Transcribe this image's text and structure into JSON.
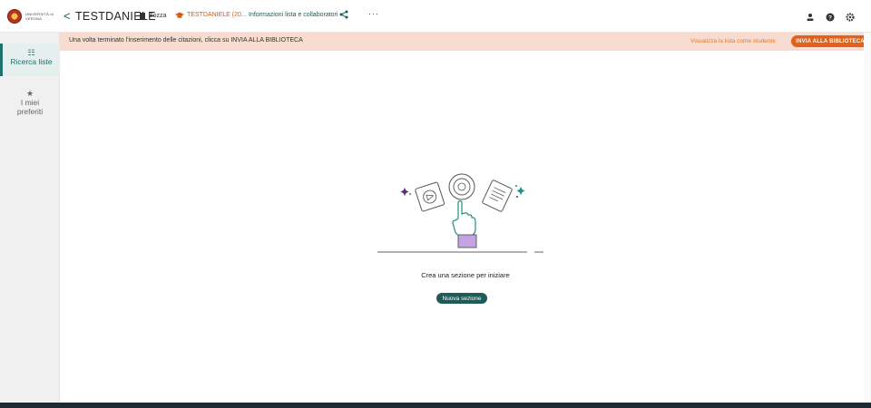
{
  "brand": {
    "logo_text": "UNIVERSITÀ di VERONA"
  },
  "header": {
    "back_glyph": "<",
    "list_title": "TESTDANIELE",
    "status_label": "Bozza",
    "course_label": "TESTDANIELE (20...",
    "info_link": "Informazioni lista e collaboratori",
    "more_glyph": "···",
    "icons": [
      "user-icon",
      "help-icon",
      "gear-icon"
    ]
  },
  "banner": {
    "message": "Una volta terminato l'inserimento delle citazioni, clicca su INVIA ALLA BIBLIOTECA",
    "student_view_link": "Visualizza la lista come studente",
    "send_button": "INVIA ALLA BIBLIOTECA"
  },
  "sidebar": {
    "items": [
      {
        "icon": "list-icon",
        "glyph": "☷",
        "label": "Ricerca liste",
        "active": true
      },
      {
        "icon": "star-icon",
        "glyph": "★",
        "label_line1": "I miei",
        "label_line2": "preferiti",
        "active": false
      }
    ]
  },
  "main": {
    "empty_message": "Crea una sezione per iniziare",
    "new_section_button": "Nuova sezione"
  },
  "colors": {
    "accent": "#1f5c58",
    "banner_bg": "#f8dcd0",
    "banner_button": "#e1611a",
    "course_orange": "#d35a12"
  }
}
